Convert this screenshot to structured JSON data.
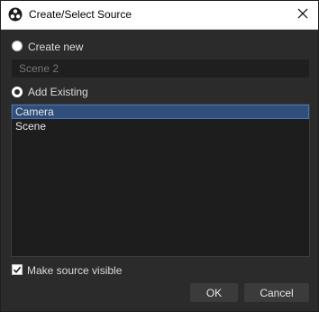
{
  "window": {
    "title": "Create/Select Source",
    "app_icon": "obs-logo-icon",
    "close_icon": "close-icon"
  },
  "create_new": {
    "label": "Create new",
    "checked": false,
    "name_placeholder": "Scene 2"
  },
  "add_existing": {
    "label": "Add Existing",
    "checked": true,
    "items": [
      {
        "label": "Camera",
        "selected": true
      },
      {
        "label": "Scene",
        "selected": false
      }
    ]
  },
  "make_visible": {
    "label": "Make source visible",
    "checked": true
  },
  "buttons": {
    "ok_label": "OK",
    "cancel_label": "Cancel"
  },
  "colors": {
    "background": "#2b2b2b",
    "titlebar": "#ffffff",
    "selection": "#2f4e7a",
    "selection_border": "#4a74b5",
    "button": "#3b3b3b"
  }
}
